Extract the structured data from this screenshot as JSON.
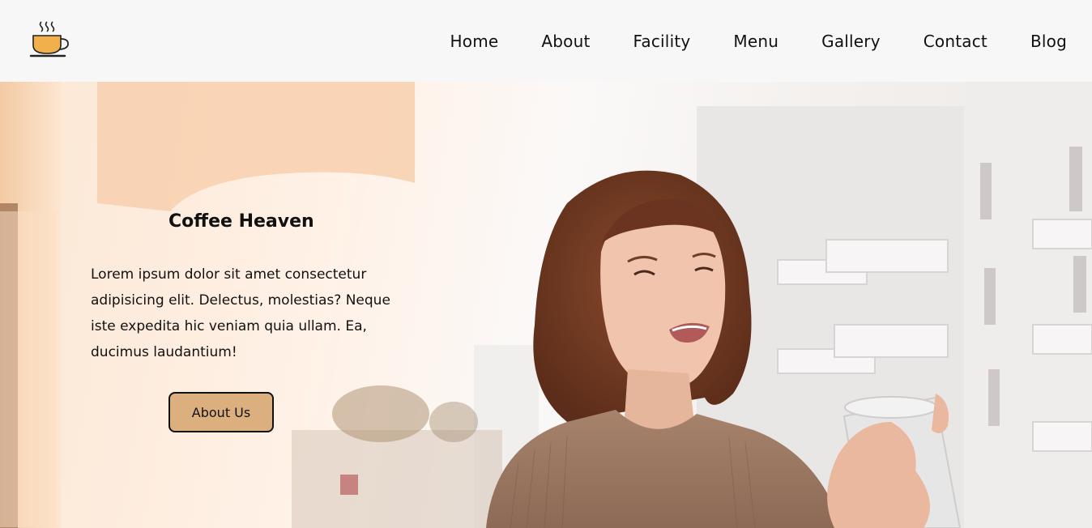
{
  "brand": {
    "logo_icon": "coffee-cup-icon"
  },
  "nav": {
    "items": [
      "Home",
      "About",
      "Facility",
      "Menu",
      "Gallery",
      "Contact",
      "Blog"
    ]
  },
  "hero": {
    "title": "Coffee Heaven",
    "text": "Lorem ipsum dolor sit amet consectetur adipisicing elit. Delectus, molestias? Neque iste expedita hic veniam quia ullam. Ea, ducimus laudantium!",
    "button_label": "About Us",
    "background": "photo-woman-drinking-coffee-on-balcony"
  },
  "colors": {
    "button_bg": "#dcb07e",
    "logo_cup": "#f2b04c",
    "header_bg": "#f7f7f8"
  }
}
